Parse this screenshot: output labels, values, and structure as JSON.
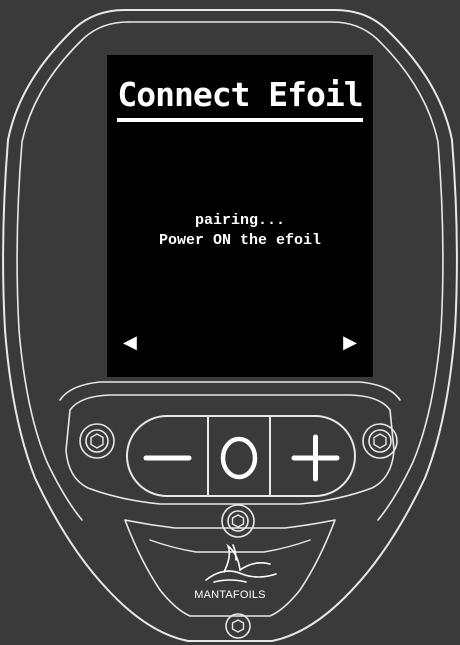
{
  "screen": {
    "title": "Connect Efoil",
    "status_line_1": "pairing...",
    "status_line_2": "Power ON the efoil",
    "nav_left": "◀",
    "nav_right": "▶"
  },
  "buttons": {
    "minus_icon": "minus-icon",
    "center_icon": "circle-icon",
    "plus_icon": "plus-icon"
  },
  "brand": {
    "name": "MANTAFOILS"
  },
  "colors": {
    "background": "#3a3a3a",
    "outline": "#e8e8e8",
    "screen": "#000000",
    "text": "#ffffff"
  }
}
